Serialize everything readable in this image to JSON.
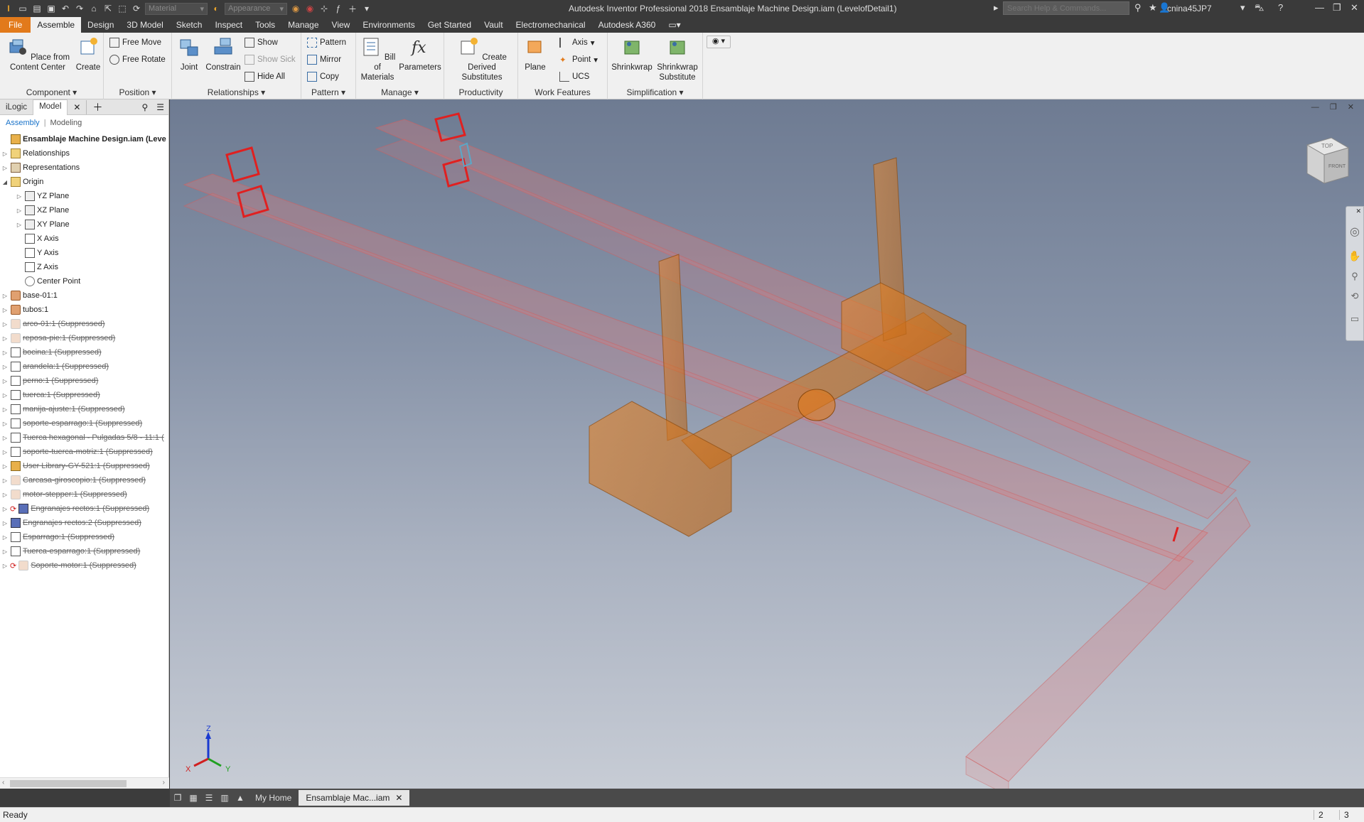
{
  "app": {
    "window_title": "Autodesk Inventor Professional 2018   Ensamblaje Machine Design.iam (LevelofDetail1)",
    "search_placeholder": "Search Help & Commands...",
    "user": "cnina45JP7",
    "material_dropdown": "Material",
    "appearance_dropdown": "Appearance"
  },
  "menu": {
    "tabs": [
      "File",
      "Assemble",
      "Design",
      "3D Model",
      "Sketch",
      "Inspect",
      "Tools",
      "Manage",
      "View",
      "Environments",
      "Get Started",
      "Vault",
      "Electromechanical",
      "Autodesk A360"
    ],
    "active": "Assemble"
  },
  "ribbon": {
    "component": {
      "title": "Component",
      "place": "Place from Content Center",
      "create": "Create"
    },
    "position": {
      "title": "Position",
      "free_move": "Free Move",
      "free_rotate": "Free Rotate"
    },
    "relationships": {
      "title": "Relationships",
      "joint": "Joint",
      "constrain": "Constrain",
      "show": "Show",
      "show_sick": "Show Sick",
      "hide_all": "Hide All"
    },
    "pattern": {
      "title": "Pattern",
      "pattern": "Pattern",
      "mirror": "Mirror",
      "copy": "Copy"
    },
    "manage": {
      "title": "Manage",
      "bom": "Bill of Materials",
      "parameters": "Parameters"
    },
    "productivity": {
      "title": "Productivity",
      "create_derived": "Create Derived Substitutes"
    },
    "work_features": {
      "title": "Work Features",
      "plane": "Plane",
      "axis": "Axis",
      "point": "Point",
      "ucs": "UCS"
    },
    "simplification": {
      "title": "Simplification",
      "shrinkwrap": "Shrinkwrap",
      "shrinkwrap_sub": "Shrinkwrap Substitute"
    }
  },
  "browser": {
    "tabs": [
      "iLogic",
      "Model"
    ],
    "active_tab": "Model",
    "sub_assembly": "Assembly",
    "sub_modeling": "Modeling",
    "items": [
      {
        "label": "Ensamblaje Machine Design.iam (Leve",
        "level": 0,
        "icon": "assembly-icon",
        "root": true,
        "suppressed": false,
        "expander": ""
      },
      {
        "label": "Relationships",
        "level": 1,
        "icon": "folder-icon",
        "suppressed": false,
        "expander": "▷"
      },
      {
        "label": "Representations",
        "level": 1,
        "icon": "representations-icon",
        "suppressed": false,
        "expander": "▷"
      },
      {
        "label": "Origin",
        "level": 1,
        "icon": "folder-icon",
        "suppressed": false,
        "expander": "◢"
      },
      {
        "label": "YZ Plane",
        "level": 2,
        "icon": "plane-icon",
        "suppressed": false,
        "expander": "▷"
      },
      {
        "label": "XZ Plane",
        "level": 2,
        "icon": "plane-icon",
        "suppressed": false,
        "expander": "▷"
      },
      {
        "label": "XY Plane",
        "level": 2,
        "icon": "plane-icon",
        "suppressed": false,
        "expander": "▷"
      },
      {
        "label": "X Axis",
        "level": 2,
        "icon": "axis-icon",
        "suppressed": false,
        "expander": ""
      },
      {
        "label": "Y Axis",
        "level": 2,
        "icon": "axis-icon",
        "suppressed": false,
        "expander": ""
      },
      {
        "label": "Z Axis",
        "level": 2,
        "icon": "axis-icon",
        "suppressed": false,
        "expander": ""
      },
      {
        "label": "Center Point",
        "level": 2,
        "icon": "point-icon",
        "suppressed": false,
        "expander": ""
      },
      {
        "label": "base-01:1",
        "level": 1,
        "icon": "part-icon",
        "suppressed": false,
        "expander": "▷"
      },
      {
        "label": "tubos:1",
        "level": 1,
        "icon": "part-icon",
        "suppressed": false,
        "expander": "▷"
      },
      {
        "label": "arco-01:1 (Suppressed)",
        "level": 1,
        "icon": "part-faded-icon",
        "suppressed": true,
        "expander": "▷"
      },
      {
        "label": "reposa-pie:1 (Suppressed)",
        "level": 1,
        "icon": "part-faded-icon",
        "suppressed": true,
        "expander": "▷"
      },
      {
        "label": "bocina:1 (Suppressed)",
        "level": 1,
        "icon": "box-icon",
        "suppressed": true,
        "expander": "▷"
      },
      {
        "label": "arandela:1 (Suppressed)",
        "level": 1,
        "icon": "box-icon",
        "suppressed": true,
        "expander": "▷"
      },
      {
        "label": "perno:1 (Suppressed)",
        "level": 1,
        "icon": "box-icon",
        "suppressed": true,
        "expander": "▷"
      },
      {
        "label": "tuerca:1 (Suppressed)",
        "level": 1,
        "icon": "box-icon",
        "suppressed": true,
        "expander": "▷"
      },
      {
        "label": "manija-ajuste:1 (Suppressed)",
        "level": 1,
        "icon": "box-icon",
        "suppressed": true,
        "expander": "▷"
      },
      {
        "label": "soporte-esparrago:1 (Suppressed)",
        "level": 1,
        "icon": "box-icon",
        "suppressed": true,
        "expander": "▷"
      },
      {
        "label": "Tuerca hexagonal - Pulgadas 5/8 - 11:1 (",
        "level": 1,
        "icon": "box-icon",
        "suppressed": true,
        "expander": "▷"
      },
      {
        "label": "soporte-tuerca-motriz:1 (Suppressed)",
        "level": 1,
        "icon": "box-icon",
        "suppressed": true,
        "expander": "▷"
      },
      {
        "label": "User Library-GY-521:1 (Suppressed)",
        "level": 1,
        "icon": "assembly-icon",
        "suppressed": true,
        "expander": "▷"
      },
      {
        "label": "Carcasa-giroscopio:1 (Suppressed)",
        "level": 1,
        "icon": "part-faded-icon",
        "suppressed": true,
        "expander": "▷"
      },
      {
        "label": "motor-stepper:1 (Suppressed)",
        "level": 1,
        "icon": "part-faded-icon",
        "suppressed": true,
        "expander": "▷"
      },
      {
        "label": "Engranajes rectos:1 (Suppressed)",
        "level": 1,
        "icon": "gear-icon",
        "suppressed": true,
        "expander": "▷",
        "indent": true
      },
      {
        "label": "Engranajes rectos:2 (Suppressed)",
        "level": 1,
        "icon": "gear-icon",
        "suppressed": true,
        "expander": "▷"
      },
      {
        "label": "Esparrago:1 (Suppressed)",
        "level": 1,
        "icon": "box-icon",
        "suppressed": true,
        "expander": "▷"
      },
      {
        "label": "Tuerca-esparrago:1 (Suppressed)",
        "level": 1,
        "icon": "box-icon",
        "suppressed": true,
        "expander": "▷"
      },
      {
        "label": "Soporte-motor:1 (Suppressed)",
        "level": 1,
        "icon": "part-faded-icon",
        "suppressed": true,
        "expander": "▷",
        "indent": true
      }
    ]
  },
  "doctabs": {
    "home": "My Home",
    "active": "Ensamblaje Mac...iam"
  },
  "status": {
    "text": "Ready",
    "count1": "2",
    "count2": "3"
  },
  "triad": {
    "z": "Z",
    "x": "X",
    "y": "Y"
  },
  "viewcube": {
    "top": "TOP",
    "front": "FRONT"
  },
  "colors": {
    "accent": "#e27a1b",
    "frame": "#e0787a",
    "part": "#e07a1a"
  }
}
